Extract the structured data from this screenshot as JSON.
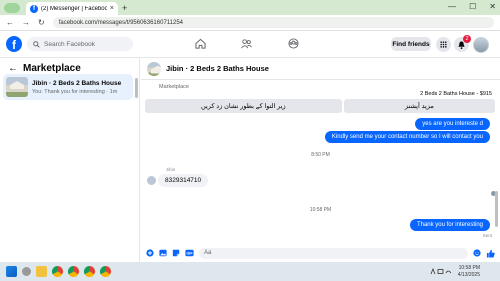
{
  "browser": {
    "tab_title": "(2) Messenger | Facebook",
    "tab_close": "×",
    "new_tab": "+",
    "url": "facebook.com/messages/t/9560636160711254",
    "win_minimize": "—",
    "win_maximize": "☐",
    "win_close": "✕",
    "nav_back": "←",
    "nav_forward": "→",
    "nav_reload": "↻"
  },
  "fb": {
    "logo": "f",
    "search_placeholder": "Search Facebook",
    "find_friends": "Find friends",
    "notification_count": "2"
  },
  "left_panel": {
    "title": "Marketplace",
    "back_arrow": "←",
    "conversations": [
      {
        "name": "Jibin · 2 Beds 2 Baths House",
        "preview": "You: Thank you for interesting · 1m"
      }
    ]
  },
  "chat": {
    "header_name": "Jibin · 2 Beds 2 Baths House",
    "marketplace_label": "Marketplace",
    "listing_title": "2 Beds 2 Baths House - $915",
    "quick_replies": [
      "زیر التوا کے بطور نشان زد کریں",
      "مزید آپشنز"
    ],
    "messages": [
      {
        "dir": "out",
        "text": "yes are you intereste d"
      },
      {
        "dir": "out",
        "text": "Kindly send me your contact number so I will contact you"
      },
      {
        "dir": "time",
        "text": "8:50 PM"
      },
      {
        "dir": "sender",
        "text": "Jibin"
      },
      {
        "dir": "in",
        "text": "8329314710"
      },
      {
        "dir": "time",
        "text": "10:58 PM"
      },
      {
        "dir": "out",
        "text": "Thank you for interesting"
      },
      {
        "dir": "status",
        "text": "Sent"
      }
    ],
    "composer_placeholder": "Aa"
  },
  "taskbar": {
    "time": "10:58 PM",
    "date": "4/13/2025"
  },
  "colors": {
    "accent": "#0866ff",
    "selected_conv": "#e7f0fd",
    "badge": "#e41e3f"
  }
}
